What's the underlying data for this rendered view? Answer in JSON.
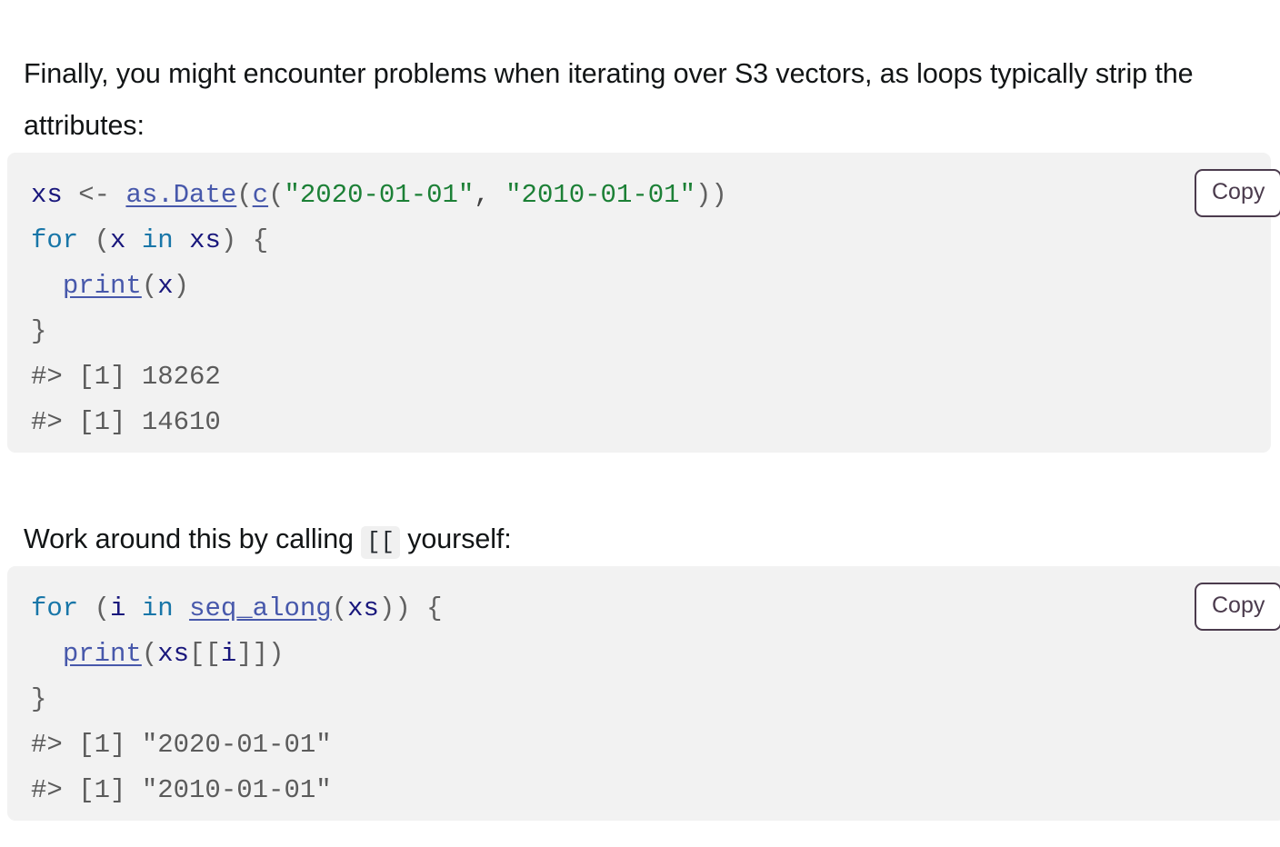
{
  "document": {
    "paragraphs": {
      "intro": "Finally, you might encounter problems when iterating over S3 vectors, as loops typically strip the attributes:",
      "workaround_before": "Work around this by calling ",
      "workaround_code": "[[",
      "workaround_after": " yourself:"
    },
    "copy_button_label": "Copy",
    "code_blocks": [
      {
        "id": "block-1",
        "language": "r",
        "copy_label": "Copy",
        "raw": "xs <- as.Date(c(\"2020-01-01\", \"2010-01-01\"))\nfor (x in xs) {\n  print(x)\n}\n#> [1] 18262\n#> [1] 14610",
        "lines": [
          {
            "n": 1,
            "text": "xs <- as.Date(c(\"2020-01-01\", \"2010-01-01\"))",
            "tokens": [
              {
                "t": "xs",
                "k": "var"
              },
              {
                "t": " ",
                "k": "plain"
              },
              {
                "t": "<-",
                "k": "punct"
              },
              {
                "t": " ",
                "k": "plain"
              },
              {
                "t": "as.Date",
                "k": "fn"
              },
              {
                "t": "(",
                "k": "punct"
              },
              {
                "t": "c",
                "k": "fn"
              },
              {
                "t": "(",
                "k": "punct"
              },
              {
                "t": "\"2020-01-01\"",
                "k": "str"
              },
              {
                "t": ",",
                "k": "plain"
              },
              {
                "t": " ",
                "k": "plain"
              },
              {
                "t": "\"2010-01-01\"",
                "k": "str"
              },
              {
                "t": "))",
                "k": "punct"
              }
            ]
          },
          {
            "n": 2,
            "text": "for (x in xs) {",
            "tokens": [
              {
                "t": "for",
                "k": "kw"
              },
              {
                "t": " ",
                "k": "plain"
              },
              {
                "t": "(",
                "k": "punct"
              },
              {
                "t": "x",
                "k": "var"
              },
              {
                "t": " ",
                "k": "plain"
              },
              {
                "t": "in",
                "k": "kw"
              },
              {
                "t": " ",
                "k": "plain"
              },
              {
                "t": "xs",
                "k": "var"
              },
              {
                "t": ")",
                "k": "punct"
              },
              {
                "t": " ",
                "k": "plain"
              },
              {
                "t": "{",
                "k": "punct"
              }
            ]
          },
          {
            "n": 3,
            "text": "  print(x)",
            "tokens": [
              {
                "t": "  ",
                "k": "plain"
              },
              {
                "t": "print",
                "k": "fn"
              },
              {
                "t": "(",
                "k": "punct"
              },
              {
                "t": "x",
                "k": "var"
              },
              {
                "t": ")",
                "k": "punct"
              }
            ]
          },
          {
            "n": 4,
            "text": "}",
            "tokens": [
              {
                "t": "}",
                "k": "punct"
              }
            ]
          },
          {
            "n": 5,
            "text": "#> [1] 18262",
            "tokens": [
              {
                "t": "#> [1] 18262",
                "k": "out"
              }
            ]
          },
          {
            "n": 6,
            "text": "#> [1] 14610",
            "tokens": [
              {
                "t": "#> [1] 14610",
                "k": "out"
              }
            ]
          }
        ]
      },
      {
        "id": "block-2",
        "language": "r",
        "copy_label": "Copy",
        "raw": "for (i in seq_along(xs)) {\n  print(xs[[i]])\n}\n#> [1] \"2020-01-01\"\n#> [1] \"2010-01-01\"",
        "lines": [
          {
            "n": 1,
            "text": "for (i in seq_along(xs)) {",
            "tokens": [
              {
                "t": "for",
                "k": "kw"
              },
              {
                "t": " ",
                "k": "plain"
              },
              {
                "t": "(",
                "k": "punct"
              },
              {
                "t": "i",
                "k": "var"
              },
              {
                "t": " ",
                "k": "plain"
              },
              {
                "t": "in",
                "k": "kw"
              },
              {
                "t": " ",
                "k": "plain"
              },
              {
                "t": "seq_along",
                "k": "fn"
              },
              {
                "t": "(",
                "k": "punct"
              },
              {
                "t": "xs",
                "k": "var"
              },
              {
                "t": "))",
                "k": "punct"
              },
              {
                "t": " ",
                "k": "plain"
              },
              {
                "t": "{",
                "k": "punct"
              }
            ]
          },
          {
            "n": 2,
            "text": "  print(xs[[i]])",
            "tokens": [
              {
                "t": "  ",
                "k": "plain"
              },
              {
                "t": "print",
                "k": "fn"
              },
              {
                "t": "(",
                "k": "punct"
              },
              {
                "t": "xs",
                "k": "var"
              },
              {
                "t": "[[",
                "k": "punct"
              },
              {
                "t": "i",
                "k": "var"
              },
              {
                "t": "]])",
                "k": "punct"
              }
            ]
          },
          {
            "n": 3,
            "text": "}",
            "tokens": [
              {
                "t": "}",
                "k": "punct"
              }
            ]
          },
          {
            "n": 4,
            "text": "#> [1] \"2020-01-01\"",
            "tokens": [
              {
                "t": "#> [1] \"2020-01-01\"",
                "k": "out"
              }
            ]
          },
          {
            "n": 5,
            "text": "#> [1] \"2010-01-01\"",
            "tokens": [
              {
                "t": "#> [1] \"2010-01-01\"",
                "k": "out"
              }
            ]
          }
        ]
      }
    ]
  },
  "colors": {
    "page_background": "#ffffff",
    "code_background": "#f2f2f2",
    "inline_code_background": "#f0f0f0",
    "body_text": "#121516",
    "code_default": "#404040",
    "token_variable": "#19177C",
    "token_keyword": "#1876A8",
    "token_function": "#4758AB",
    "token_string": "#1C8036",
    "token_output": "#5b5b5b",
    "copy_button_border": "#4b3b4d"
  }
}
